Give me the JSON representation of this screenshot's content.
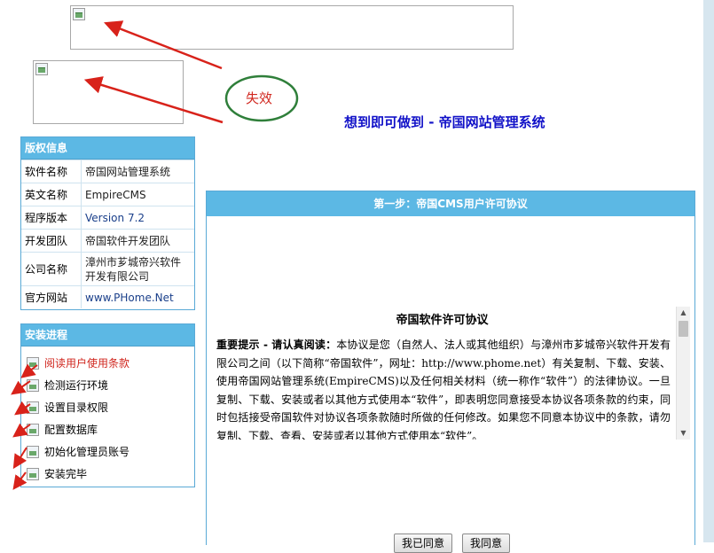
{
  "header": {
    "site_title": "想到即可做到 - 帝国网站管理系统",
    "callout_text": "失效"
  },
  "copyright": {
    "title": "版权信息",
    "rows": [
      {
        "label": "软件名称",
        "value": "帝国网站管理系统"
      },
      {
        "label": "英文名称",
        "value": "EmpireCMS"
      },
      {
        "label": "程序版本",
        "value": "Version 7.2"
      },
      {
        "label": "开发团队",
        "value": "帝国软件开发团队"
      },
      {
        "label": "公司名称",
        "value": "漳州市芗城帝兴软件开发有限公司"
      },
      {
        "label": "官方网站",
        "value": "www.PHome.Net"
      }
    ]
  },
  "progress": {
    "title": "安装进程",
    "steps": [
      {
        "label": "阅读用户使用条款",
        "active": true
      },
      {
        "label": "检测运行环境",
        "active": false
      },
      {
        "label": "设置目录权限",
        "active": false
      },
      {
        "label": "配置数据库",
        "active": false
      },
      {
        "label": "初始化管理员账号",
        "active": false
      },
      {
        "label": "安装完毕",
        "active": false
      }
    ]
  },
  "main": {
    "step_title": "第一步：帝国CMS用户许可协议",
    "agreement_title": "帝国软件许可协议",
    "agreement_lead": "重要提示 - 请认真阅读：",
    "agreement_text": "本协议是您（自然人、法人或其他组织）与漳州市芗城帝兴软件开发有限公司之间（以下简称“帝国软件”，网址：http://www.phome.net）有关复制、下载、安装、使用帝国网站管理系统(EmpireCMS)以及任何相关材料（统一称作“软件”）的法律协议。一旦复制、下载、安装或者以其他方式使用本“软件”，即表明您同意接受本协议各项条款的约束，同时包括接受帝国软件对协议各项条款随时所做的任何修改。如果您不同意本协议中的条款，请勿复制、下载、查看、安装或者以其他方式使用本“软件”。",
    "agree_button": "我已同意",
    "disagree_button": "我同意"
  },
  "colors": {
    "panel_header": "#5cb8e4",
    "title_blue": "#1212c8",
    "annotation_red": "#d0261e",
    "annotation_green": "#2f7f3a"
  }
}
